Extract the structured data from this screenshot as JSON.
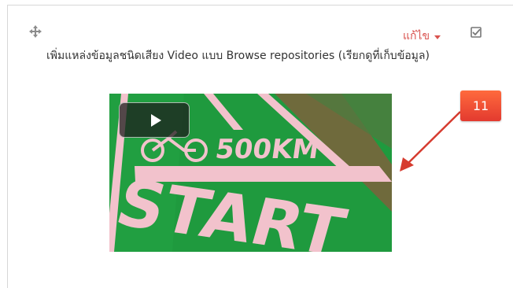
{
  "activity": {
    "title": "เพิ่มแหล่งข้อมูลชนิดเสียง Video แบบ Browse repositories (เรียกดูที่เก็บข้อมูล)",
    "edit_label": "แก้ไข",
    "icons": {
      "move": "move-icon",
      "dropdown": "caret-down-icon",
      "select": "checkbox-icon",
      "play": "play-icon"
    },
    "edit_color": "#d9534f"
  },
  "video": {
    "scene_text": "500KM START"
  },
  "annotation": {
    "number": "11",
    "color": "#e33a2f"
  }
}
